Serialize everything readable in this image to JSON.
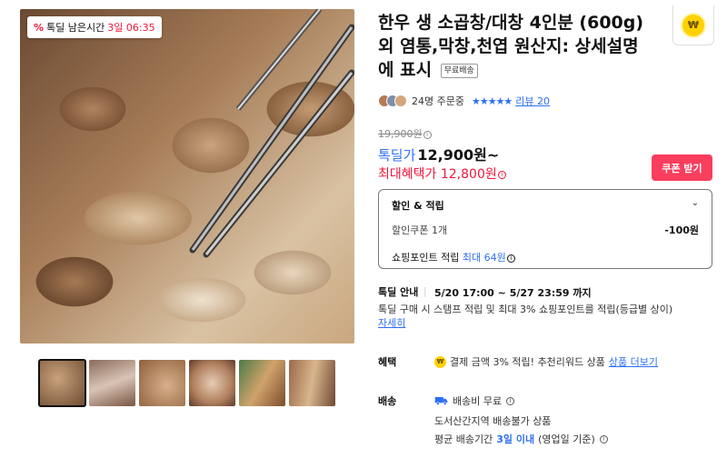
{
  "gallery": {
    "badge_label": "톡딜 남은시간",
    "badge_time": "3일 06:35"
  },
  "product": {
    "title": "한우 생 소곱창/대창 4인분 (600g) 외 염통,막창,천엽 원산지: 상세설명에 표시",
    "free_shipping_tag": "무료배송"
  },
  "buyers": {
    "count_text": "24명 주문중",
    "stars": "★★★★★",
    "review_text": "리뷰 20"
  },
  "price": {
    "original": "19,900원",
    "deal_label": "톡딜가",
    "deal_value": "12,900원~",
    "max_label": "최대혜택가",
    "max_value": "12,800원",
    "coupon_button": "쿠폰 받기"
  },
  "benefits_box": {
    "title": "할인 & 적립",
    "coupon_label": "할인쿠폰 1개",
    "coupon_amount": "-100원",
    "points_label": "쇼핑포인트 적립",
    "points_max": "최대 64원"
  },
  "deal_period": {
    "label": "톡딜 안내",
    "range": "5/20 17:00 ~ 5/27 23:59 까지",
    "desc": "톡딜 구매 시 스탬프 적립 및 최대 3% 쇼핑포인트를 적립(등급별 상이)",
    "more_link": "자세히"
  },
  "benefit_section": {
    "label": "혜택",
    "coin_symbol": "₩",
    "text": "결제 금액 3% 적립! 추천리워드 상품",
    "link": "상품 더보기"
  },
  "shipping": {
    "label": "배송",
    "fee": "배송비 무료",
    "restriction": "도서산간지역 배송불가 상품",
    "eta_prefix": "평균 배송기간",
    "eta_value": "3일 이내",
    "eta_suffix": "(영업일 기준)"
  },
  "colors": {
    "accent_blue": "#2f6ff3",
    "accent_red": "#f0163a",
    "coupon_button": "#fa3e5e",
    "coin_yellow": "#ffd100"
  }
}
